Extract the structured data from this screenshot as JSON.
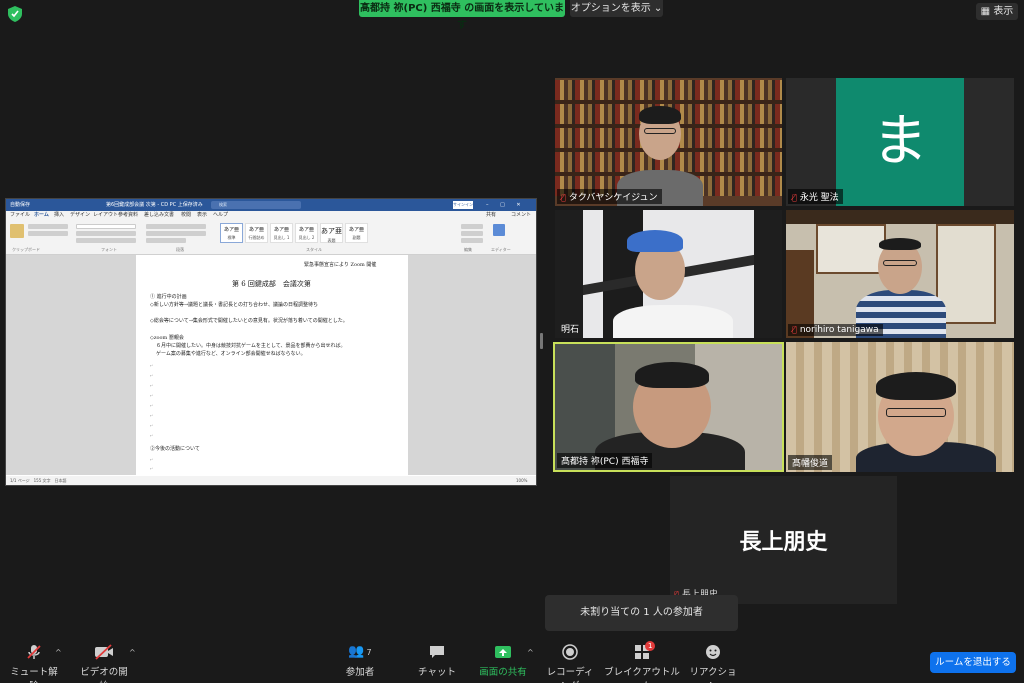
{
  "top": {
    "share_banner": "髙都持 祢(PC) 西福寺 の画面を表示しています",
    "options": "オプションを表示",
    "view": "表示"
  },
  "doc": {
    "autosave": "自動保存",
    "doc_title": "第6回鍵成部会議 次第 - CD PC 上保存済み",
    "search_placeholder": "検索",
    "signin": "サインイン",
    "tabs": [
      "ファイル",
      "ホーム",
      "挿入",
      "デザイン",
      "レイアウト",
      "参考資料",
      "差し込み文書",
      "校閲",
      "表示",
      "ヘルプ"
    ],
    "share": "共有",
    "comment": "コメント",
    "styles": [
      {
        "sample": "あア亜",
        "name": "標準"
      },
      {
        "sample": "あア亜",
        "name": "行間詰め"
      },
      {
        "sample": "あア亜",
        "name": "見出し 1"
      },
      {
        "sample": "あア亜",
        "name": "見出し 2"
      },
      {
        "sample": "あア亜",
        "name": "表題"
      },
      {
        "sample": "あア亜",
        "name": "副題"
      }
    ],
    "groups": [
      "クリップボード",
      "フォント",
      "段落",
      "スタイル",
      "編集",
      "エディター"
    ],
    "lines": {
      "top_right": "緊急事態宣言により Zoom 開催",
      "heading": "第 6 回鍵成部　会議次第",
      "item1": "① 進行中の計画",
      "item1a": "◇新しい方針等→議題と議長・書記長との打ち合わせ、議論の日程調整待ち",
      "item1b": "◇総会等について→集会形式で開催したいとの意見有。状況が落ち着いての開催とした。",
      "item1c": "◇zoom 懇親会",
      "item1d": "６月中に開催したい。中身は競技対抗ゲームを主として、景品を部費から出せれば。",
      "item1e": "ゲーム案の募集や進行など、オンライン部会開催せねばならない。",
      "item2": "②今後の活動について"
    },
    "status": "1/1 ページ　155 文字　日本語",
    "zoom": "100%"
  },
  "tiles": [
    {
      "name": "タクバヤシケイジュン",
      "muted": true
    },
    {
      "name": "永光 聖法",
      "muted": true,
      "avatar_letter": "ま"
    },
    {
      "name": "明石",
      "muted": false
    },
    {
      "name": "norihiro tanigawa",
      "muted": true
    },
    {
      "name": "髙都持 祢(PC) 西福寺",
      "muted": false,
      "active": true
    },
    {
      "name": "髙幡俊道",
      "muted": false
    },
    {
      "name": "長上朋史",
      "muted": true,
      "label": "長上朋史"
    }
  ],
  "unassigned": "未割り当ての 1 人の参加者",
  "toolbar": {
    "mute": "ミュート解除",
    "video": "ビデオの開始",
    "participants": "参加者",
    "participants_count": "7",
    "chat": "チャット",
    "share": "画面の共有",
    "record": "レコーディング",
    "breakout": "ブレイクアウトルーム",
    "breakout_badge": "1",
    "reactions": "リアクション",
    "leave": "ルームを退出する"
  },
  "colors": {
    "banner": "#2fbf5f",
    "active_border": "#c8e05a",
    "leave": "#0e72ed",
    "avatar": "#0f8a6e",
    "word": "#2b579a"
  }
}
